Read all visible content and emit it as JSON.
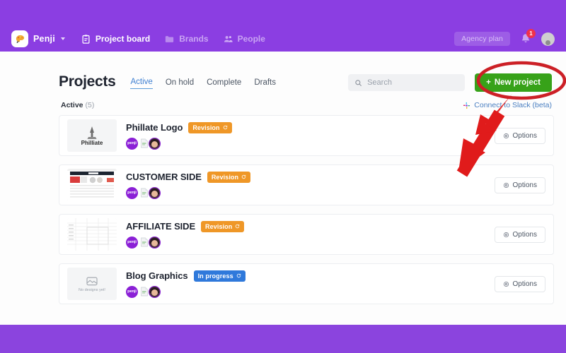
{
  "colors": {
    "purple_navbar": "#8b3ee2",
    "purple_band_bottom": "#8b44de",
    "green_button": "#37a219",
    "badge_revision": "#ef9727",
    "badge_progress": "#2f79db",
    "tab_active": "#3e7fd1",
    "annotation_red": "#cc2026",
    "page_background": "#fdfdfd"
  },
  "navbar": {
    "brand": {
      "logo_icon": "paint-palette-icon",
      "name": "Penji",
      "caret_icon": "caret-down-icon"
    },
    "items": [
      {
        "label": "Project board",
        "icon": "clipboard-icon",
        "state": "active"
      },
      {
        "label": "Brands",
        "icon": "folder-icon",
        "state": "inactive"
      },
      {
        "label": "People",
        "icon": "people-icon",
        "state": "inactive"
      }
    ],
    "plan_pill": "Agency plan",
    "notification_icon": "bell-icon",
    "notification_count": "1",
    "avatar_icon": "user-avatar-icon"
  },
  "page": {
    "title": "Projects",
    "tabs": [
      {
        "label": "Active",
        "active": true
      },
      {
        "label": "On hold",
        "active": false
      },
      {
        "label": "Complete",
        "active": false
      },
      {
        "label": "Drafts",
        "active": false
      }
    ],
    "search": {
      "value": "",
      "placeholder": "Search",
      "icon": "search-icon"
    },
    "new_project_button": {
      "label": "New project",
      "plus": "+",
      "icon": "plus-icon"
    },
    "section_label": "Active",
    "section_count": "(5)",
    "slack_link": {
      "label": "Connect to Slack (beta)",
      "icon": "slack-icon"
    },
    "options_label": "Options",
    "options_icon": "gear-icon",
    "empty_thumb_caption": "No designs yet!",
    "empty_thumb_icon": "image-placeholder-icon",
    "avatar_penji_label": "penji",
    "projects": [
      {
        "title": "Phillate Logo",
        "status": "Revision",
        "status_type": "revision",
        "status_icon": "refresh-icon",
        "thumb_type": "logo",
        "thumb_label": "Philliate"
      },
      {
        "title": "CUSTOMER SIDE",
        "status": "Revision",
        "status_type": "revision",
        "status_icon": "refresh-icon",
        "thumb_type": "website",
        "thumb_label": ""
      },
      {
        "title": "AFFILIATE SIDE",
        "status": "Revision",
        "status_type": "revision",
        "status_icon": "refresh-icon",
        "thumb_type": "spreadsheet",
        "thumb_label": ""
      },
      {
        "title": "Blog Graphics",
        "status": "In progress",
        "status_type": "progress",
        "status_icon": "refresh-icon",
        "thumb_type": "empty",
        "thumb_label": "No designs yet!"
      }
    ]
  },
  "annotations": {
    "ellipse_target": "new-project-button",
    "arrow_direction": "up-right",
    "color": "#cc2026"
  }
}
